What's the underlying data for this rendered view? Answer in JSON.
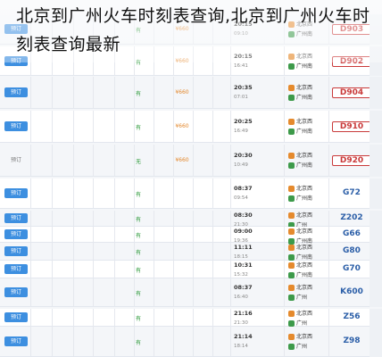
{
  "page": {
    "title": "北京到广州火车时刻表查询,北京到广州火车时刻表查询最新"
  },
  "ui": {
    "book_label": "预订",
    "book_disabled_label": "预订"
  },
  "rows": [
    {
      "train": "D903",
      "depart": "20:15",
      "arrive": "09:10",
      "from": "北京西",
      "to": "广州南",
      "book": "预订",
      "book_enabled": true,
      "seat": "有",
      "price": "¥660",
      "red": true
    },
    {
      "train": "D902",
      "depart": "20:15",
      "arrive": "16:41",
      "from": "北京西",
      "to": "广州南",
      "book": "预订",
      "book_enabled": true,
      "seat": "有",
      "price": "¥660",
      "red": true
    },
    {
      "train": "D904",
      "depart": "20:35",
      "arrive": "07:01",
      "from": "北京西",
      "to": "广州南",
      "book": "预订",
      "book_enabled": true,
      "seat": "有",
      "price": "¥660",
      "red": true
    },
    {
      "train": "D910",
      "depart": "20:25",
      "arrive": "16:49",
      "from": "北京西",
      "to": "广州南",
      "book": "预订",
      "book_enabled": true,
      "seat": "有",
      "price": "¥660",
      "red": true
    },
    {
      "train": "D920",
      "depart": "20:30",
      "arrive": "10:49",
      "from": "北京西",
      "to": "广州南",
      "book": "预订",
      "book_enabled": false,
      "seat": "无",
      "price": "¥660",
      "red": true
    },
    {
      "train": "G72",
      "depart": "08:37",
      "arrive": "09:54",
      "from": "北京西",
      "to": "广州南",
      "book": "预订",
      "book_enabled": true,
      "seat": "有",
      "price": "",
      "red": false
    },
    {
      "train": "Z202",
      "depart": "08:30",
      "arrive": "21:30",
      "from": "北京西",
      "to": "广州",
      "book": "预订",
      "book_enabled": true,
      "seat": "有",
      "price": "",
      "red": false
    },
    {
      "train": "G66",
      "depart": "09:00",
      "arrive": "19:36",
      "from": "北京西",
      "to": "广州南",
      "book": "预订",
      "book_enabled": true,
      "seat": "有",
      "price": "",
      "red": false
    },
    {
      "train": "G80",
      "depart": "11:11",
      "arrive": "18:15",
      "from": "北京西",
      "to": "广州南",
      "book": "预订",
      "book_enabled": true,
      "seat": "有",
      "price": "",
      "red": false
    },
    {
      "train": "G70",
      "depart": "10:31",
      "arrive": "15:32",
      "from": "北京西",
      "to": "广州南",
      "book": "预订",
      "book_enabled": true,
      "seat": "有",
      "price": "",
      "red": false
    },
    {
      "train": "K600",
      "depart": "08:37",
      "arrive": "16:40",
      "from": "北京西",
      "to": "广州",
      "book": "预订",
      "book_enabled": true,
      "seat": "有",
      "price": "",
      "red": false
    },
    {
      "train": "Z56",
      "depart": "21:16",
      "arrive": "21:30",
      "from": "北京西",
      "to": "广州",
      "book": "预订",
      "book_enabled": true,
      "seat": "有",
      "price": "",
      "red": false
    },
    {
      "train": "Z98",
      "depart": "21:14",
      "arrive": "18:14",
      "from": "北京西",
      "to": "广州",
      "book": "预订",
      "book_enabled": true,
      "seat": "有",
      "price": "",
      "red": false
    }
  ],
  "colors": {
    "book": "#3d8fe0",
    "train_blue": "#2c5fa8",
    "train_red": "#c93a3a"
  }
}
